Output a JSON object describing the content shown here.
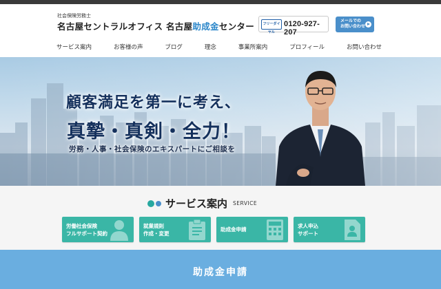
{
  "header": {
    "logo_sub": "社会保険労務士",
    "logo_main_a": "名古屋セントラルオフィス 名古屋",
    "logo_main_highlight": "助成金",
    "logo_main_b": "センター",
    "freecall_badge": "フリーダイヤル",
    "phone": "0120-927-207",
    "mail_line1": "メールでの",
    "mail_line2": "お問い合わせ"
  },
  "nav": {
    "items": [
      {
        "label": "サービス案内"
      },
      {
        "label": "お客様の声"
      },
      {
        "label": "ブログ"
      },
      {
        "label": "理念"
      },
      {
        "label": "事業所案内"
      },
      {
        "label": "プロフィール"
      },
      {
        "label": "お問い合わせ"
      }
    ]
  },
  "hero": {
    "line1": "顧客満足を第一に考え、",
    "line2": "真摯・真剣・全力！",
    "line3": "労務・人事・社会保険のエキスパートにご相談を"
  },
  "services": {
    "title": "サービス案内",
    "subtitle": "SERVICE",
    "buttons": [
      {
        "line1": "労働社会保険",
        "line2": "フルサポート契約",
        "icon": "person-icon"
      },
      {
        "line1": "就業規則",
        "line2": "作成・変更",
        "icon": "clipboard-icon"
      },
      {
        "line1": "助成金申請",
        "line2": "",
        "icon": "calculator-icon"
      },
      {
        "line1": "求人申込",
        "line2": "サポート",
        "icon": "document-icon"
      }
    ]
  },
  "subsidy": {
    "title": "助成金申請"
  },
  "colors": {
    "accent_teal": "#3ab6a6",
    "accent_blue": "#4a8fca",
    "hero_text": "#14305c",
    "band_blue": "#6aaee0"
  }
}
